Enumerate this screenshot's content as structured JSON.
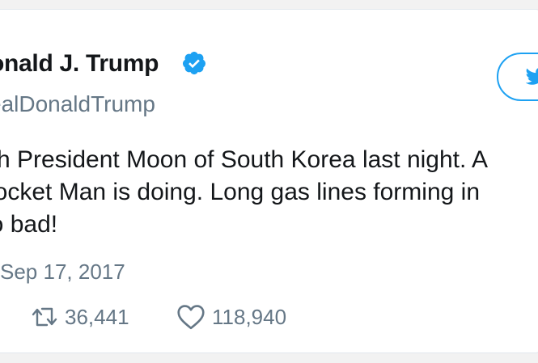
{
  "tweet": {
    "display_name": "onald J. Trump",
    "handle": "ealDonaldTrump",
    "text_lines": [
      "rith President Moon of South Korea last night. A",
      "Rocket Man is doing. Long gas lines forming in",
      "oo bad!"
    ],
    "date": "Sep 17, 2017",
    "retweet_count": "36,441",
    "like_count": "118,940"
  },
  "colors": {
    "accent": "#1da1f2",
    "text": "#14171a",
    "secondary": "#657786"
  },
  "icons": {
    "verified": "verified-badge-icon",
    "follow": "twitter-bird-icon",
    "retweet": "retweet-icon",
    "like": "heart-icon"
  }
}
